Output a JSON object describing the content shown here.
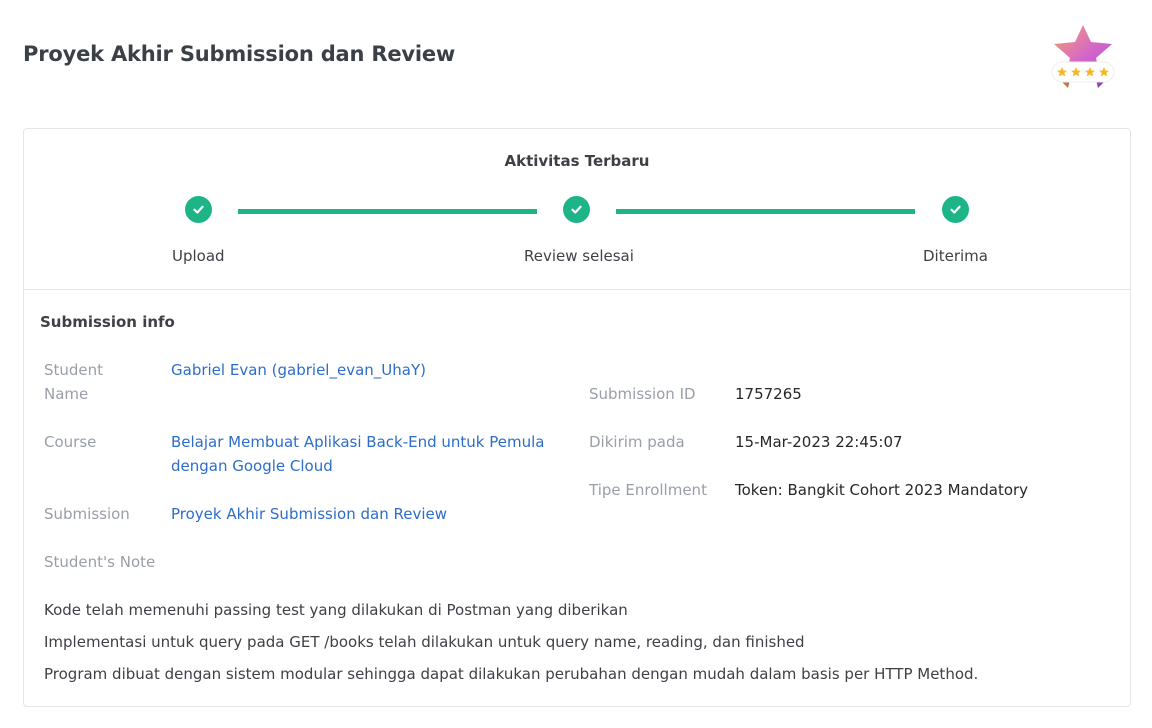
{
  "page": {
    "title": "Proyek Akhir Submission dan Review"
  },
  "badge": {
    "stars": 4,
    "colors": [
      "#f59e6b",
      "#c45dd6",
      "#b84fd0"
    ]
  },
  "progress": {
    "title": "Aktivitas Terbaru",
    "steps": [
      {
        "label": "Upload",
        "done": true
      },
      {
        "label": "Review selesai",
        "done": true
      },
      {
        "label": "Diterima",
        "done": true
      }
    ],
    "accent": "#1db588"
  },
  "submission_info": {
    "title": "Submission info",
    "student_name_label": "Student Name",
    "student_name_value": "Gabriel Evan (gabriel_evan_UhaY)",
    "course_label": "Course",
    "course_value": "Belajar Membuat Aplikasi Back-End untuk Pemula dengan Google Cloud",
    "submission_label": "Submission",
    "submission_value": "Proyek Akhir Submission dan Review",
    "notes_label": "Student's Note",
    "submission_id_label": "Submission ID",
    "submission_id_value": "1757265",
    "sent_at_label": "Dikirim pada",
    "sent_at_value": "15-Mar-2023 22:45:07",
    "enrollment_label": "Tipe Enrollment",
    "enrollment_value": "Token: Bangkit Cohort 2023 Mandatory"
  },
  "notes": [
    "Kode telah memenuhi passing test yang dilakukan di Postman yang diberikan",
    "Implementasi untuk query pada GET /books telah dilakukan untuk query name, reading, dan finished",
    "Program dibuat dengan sistem modular sehingga dapat dilakukan perubahan dengan mudah dalam basis per HTTP Method."
  ],
  "link_color": "#2d6dc9"
}
